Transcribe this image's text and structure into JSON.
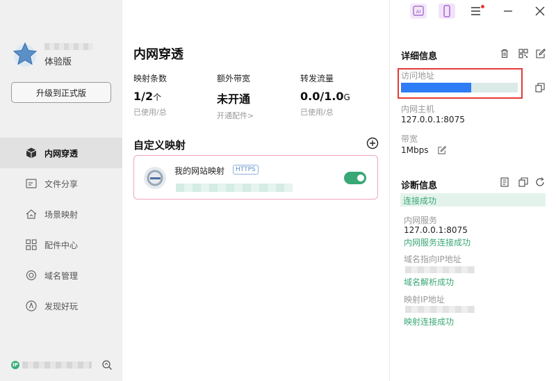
{
  "app": {
    "version_label": "体验版",
    "upgrade_button": "升级到正式版"
  },
  "sidebar": {
    "items": [
      {
        "label": "内网穿透",
        "icon": "cube-icon",
        "active": true
      },
      {
        "label": "文件分享",
        "icon": "folder-share-icon",
        "active": false
      },
      {
        "label": "场景映射",
        "icon": "home-map-icon",
        "active": false
      },
      {
        "label": "配件中心",
        "icon": "grid-icon",
        "active": false
      },
      {
        "label": "域名管理",
        "icon": "globe-icon",
        "active": false
      },
      {
        "label": "发现好玩",
        "icon": "compass-icon",
        "active": false
      }
    ],
    "footer_icon": "IP"
  },
  "main": {
    "title": "内网穿透",
    "stats": [
      {
        "label": "映射条数",
        "value": "1/2",
        "unit": "个",
        "sub": "已使用/总"
      },
      {
        "label": "额外带宽",
        "value": "未开通",
        "unit": "",
        "sub": "开通配件>"
      },
      {
        "label": "转发流量",
        "value": "0.0/1.0",
        "unit": "G",
        "sub": "已使用/总"
      }
    ],
    "custom_section_title": "自定义映射",
    "mapping": {
      "name": "我的网站映射",
      "protocol": "HTTPS",
      "enabled": true
    }
  },
  "details": {
    "title": "详细信息",
    "access_label": "访问地址",
    "host_label": "内网主机",
    "host_value": "127.0.0.1:8075",
    "bandwidth_label": "带宽",
    "bandwidth_value": "1Mbps"
  },
  "diagnosis": {
    "title": "诊断信息",
    "status": "连接成功",
    "service_label": "内网服务",
    "service_value": "127.0.0.1:8075",
    "service_ok": "内网服务连接成功",
    "domain_ip_label": "域名指向IP地址",
    "domain_ok": "域名解析成功",
    "map_ip_label": "映射IP地址",
    "map_ok": "映射连接成功"
  },
  "colors": {
    "accent_green": "#3aa776",
    "highlight_red": "#e53935",
    "card_border_pink": "#f2a6bf"
  }
}
